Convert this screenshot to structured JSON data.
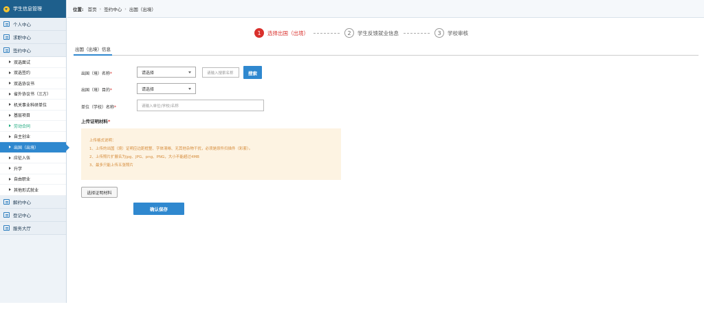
{
  "sidebar": {
    "title": "学生信息管理",
    "sections": [
      {
        "label": "个人中心"
      },
      {
        "label": "求职中心"
      },
      {
        "label": "签约中心"
      }
    ],
    "items": [
      {
        "label": "双选面试"
      },
      {
        "label": "双选签约"
      },
      {
        "label": "双选协议书"
      },
      {
        "label": "省外协议书（三方）"
      },
      {
        "label": "机关事业科研单位"
      },
      {
        "label": "基层项目"
      },
      {
        "label": "劳动合同"
      },
      {
        "label": "自主创业"
      },
      {
        "label": "出国（出境）"
      },
      {
        "label": "应征入伍"
      },
      {
        "label": "升学"
      },
      {
        "label": "自由职业"
      },
      {
        "label": "其他形式就业"
      }
    ],
    "bottom_sections": [
      {
        "label": "解约中心"
      },
      {
        "label": "登记中心"
      },
      {
        "label": "服务大厅"
      }
    ],
    "colors": {
      "header": "#1e5f8c",
      "active": "#2f88cf",
      "highlight": "#19a87c"
    }
  },
  "breadcrumb": {
    "prefix": "位置:",
    "items": [
      "首页",
      "签约中心",
      "出国（出境）"
    ],
    "separator": "›"
  },
  "steps": [
    {
      "num": "1",
      "label": "选择出国（出境）"
    },
    {
      "num": "2",
      "label": "学生反馈就业信息"
    },
    {
      "num": "3",
      "label": "学校审核"
    }
  ],
  "tab": {
    "label": "出国（出境）信息"
  },
  "form": {
    "country": {
      "label": "出国（境）名称",
      "select_value": "请选择",
      "search_placeholder": "请输入搜索名称",
      "search_button": "搜索"
    },
    "purpose": {
      "label": "出国（境）目的",
      "select_value": "请选择"
    },
    "unit": {
      "label": "单位（学校）名称",
      "placeholder": "请输入单位(学校)名称"
    },
    "required_mark": "*",
    "upload_title": "上传证明材料",
    "notice": {
      "title": "上传格式说明：",
      "lines": [
        "1、上传的出国（境）证明应边距框整、字体清晰、无其他杂物干扰，必须是原件扫描件（彩套）。",
        "2、上传照片扩展名为jpg、JPG、png、PNG，大小不能超过4MB",
        "3、最多只能上传五张照片"
      ]
    },
    "choose_button": "选择证明材料",
    "save_button": "确认保存"
  }
}
